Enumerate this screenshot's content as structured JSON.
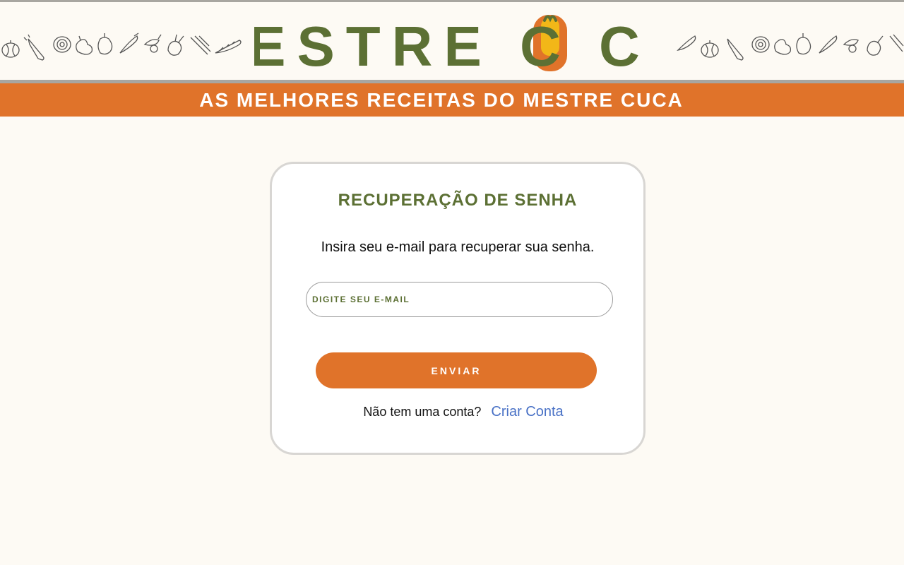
{
  "header": {
    "logo_text": "MESTRE CUCA",
    "tagline": "AS MELHORES RECEITAS DO MESTRE CUCA",
    "decoration": "vegetable-doodles-icon"
  },
  "card": {
    "title": "RECUPERAÇÃO DE SENHA",
    "description": "Insira seu e-mail para recuperar sua senha.",
    "email_placeholder": "DIGITE SEU E-MAIL",
    "email_value": "",
    "submit_label": "ENVIAR",
    "signup_prompt": "Não tem uma conta?",
    "signup_link": "Criar Conta"
  },
  "colors": {
    "background": "#fdfaf4",
    "brand_green": "#5c7034",
    "brand_orange": "#e0732a",
    "brand_yellow": "#f2b718",
    "link_blue": "#4a72c6"
  }
}
